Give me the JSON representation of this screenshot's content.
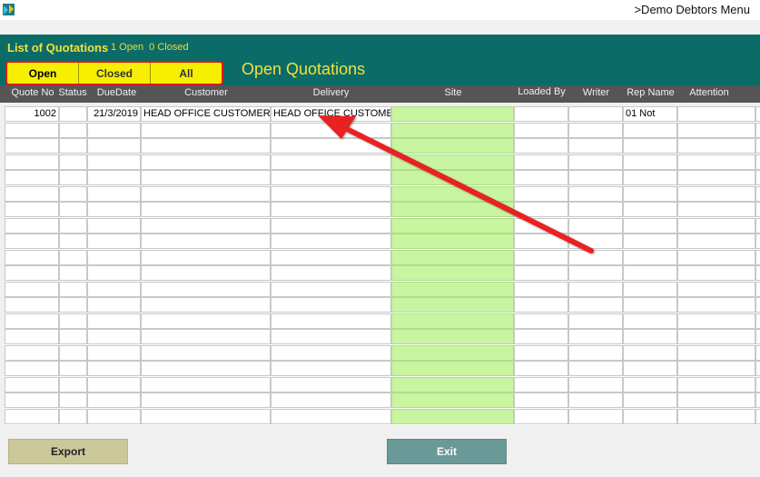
{
  "titlebar": {
    "menu_title": ">Demo Debtors Menu",
    "icon": "app-icon"
  },
  "panel": {
    "title": "List of Quotations",
    "open_count": "1 Open",
    "closed_count": "0 Closed",
    "heading": "Open Quotations"
  },
  "filters": [
    {
      "label": "Open",
      "active": true
    },
    {
      "label": "Closed",
      "active": false
    },
    {
      "label": "All",
      "active": false
    }
  ],
  "table": {
    "columns": [
      "Quote No",
      "Status",
      "DueDate",
      "Customer",
      "Delivery",
      "Site",
      "Loaded By",
      "Writer",
      "Rep Name",
      "Attention"
    ],
    "rows": [
      [
        "1002",
        "",
        "21/3/2019",
        "HEAD OFFICE CUSTOMER",
        "HEAD OFFICE CUSTOMER",
        "",
        "",
        "",
        "01 Not",
        ""
      ]
    ],
    "empty_row_count": 19
  },
  "footer": {
    "export_label": "Export",
    "exit_label": "Exit"
  },
  "colors": {
    "header_teal": "#0b6b66",
    "title_yellow": "#f3e03b",
    "site_green": "#c8f5a0",
    "annotation_red": "#e82020"
  }
}
